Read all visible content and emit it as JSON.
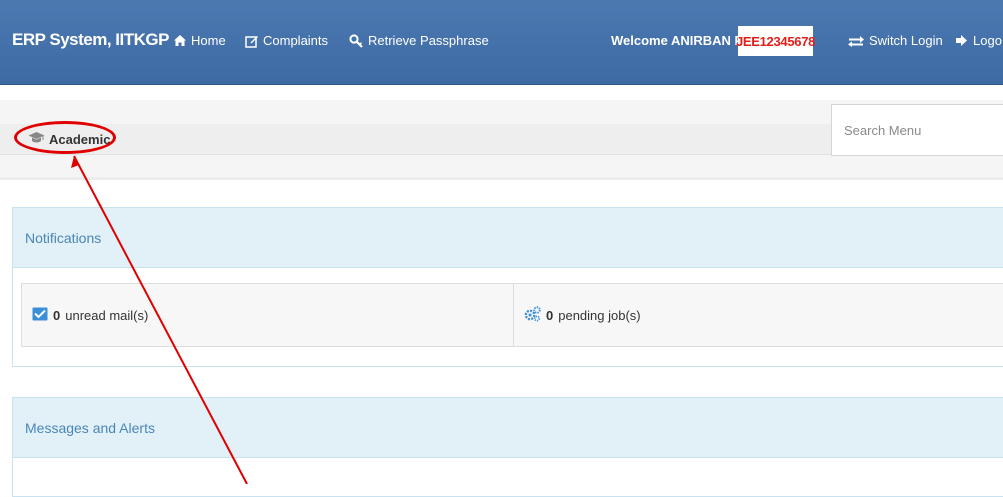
{
  "navbar": {
    "brand": "ERP System, IITKGP",
    "links": [
      {
        "label": "Home",
        "icon": "home-icon"
      },
      {
        "label": "Complaints",
        "icon": "edit-icon"
      },
      {
        "label": "Retrieve Passphrase",
        "icon": "key-icon"
      }
    ],
    "welcome": "Welcome ANIRBAN PAL",
    "roll_number": "JEE12345678",
    "switch_login": "Switch Login",
    "logout": "Logo"
  },
  "breadcrumb": {
    "label": "Academic",
    "icon": "graduation-cap-icon"
  },
  "search": {
    "placeholder": "Search Menu"
  },
  "notifications": {
    "title": "Notifications",
    "mail_count": "0",
    "mail_label": "unread mail(s)",
    "mail_icon": "envelope-check-icon",
    "jobs_count": "0",
    "jobs_label": "pending job(s)",
    "jobs_icon": "cogs-icon"
  },
  "messages": {
    "title": "Messages and Alerts"
  },
  "colors": {
    "navbar": "#4671ab",
    "panel_header": "#e2f0f8",
    "panel_title": "#4a86b7",
    "roll_number": "#e0201a",
    "annotation": "#e00000"
  }
}
